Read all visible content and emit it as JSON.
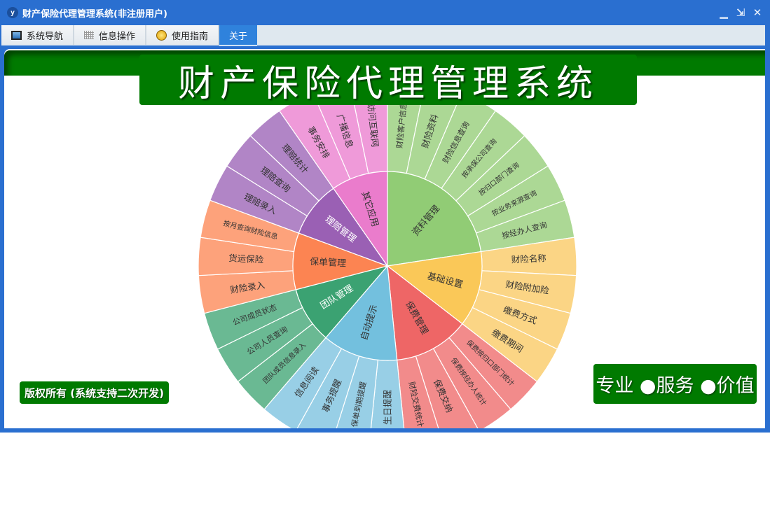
{
  "window": {
    "logo_text": "y",
    "title": "财产保险代理管理系统(非注册用户)",
    "controls": {
      "minimize": "▁",
      "restore": "⇲",
      "close": "✕"
    }
  },
  "tabs": [
    {
      "label": "系统导航",
      "icon": "monitor-icon"
    },
    {
      "label": "信息操作",
      "icon": "grid-icon"
    },
    {
      "label": "使用指南",
      "icon": "help-icon"
    },
    {
      "label": "关于",
      "active": true
    }
  ],
  "banner": {
    "title": "财产保险代理管理系统"
  },
  "footer": {
    "copyright": "版权所有 (系统支持二次开发)",
    "slogan": "专业 ●服务 ●价值"
  },
  "menu_wheel": {
    "type": "sunburst",
    "groups": [
      {
        "name": "资料管理",
        "color": "#91cc75",
        "leaf_color": "#acd895",
        "children": [
          "财险客户信息",
          "财险资料",
          "财险信息查询",
          "按承保公司查询",
          "按归口部门查询",
          "按业务来源查询",
          "按经办人查询"
        ]
      },
      {
        "name": "基础设置",
        "color": "#fac858",
        "leaf_color": "#fbd585",
        "children": [
          "财险名称",
          "财险附加险",
          "缴费方式",
          "缴费期间"
        ]
      },
      {
        "name": "保费管理",
        "color": "#ee6666",
        "leaf_color": "#f28b8b",
        "children": [
          "保费按归口部门统计",
          "保费按经办人统计",
          "保费交纳",
          "财险交费统计"
        ]
      },
      {
        "name": "自动提示",
        "color": "#73c0de",
        "leaf_color": "#98cfe6",
        "children": [
          "生日提醒",
          "保单到期提醒",
          "事务提醒",
          "信息阅读"
        ]
      },
      {
        "name": "团队管理",
        "color": "#3ba272",
        "leaf_color": "#6ab993",
        "light_label": true,
        "children": [
          "团队成员信息录入",
          "公司人员查询",
          "公司成员状态"
        ]
      },
      {
        "name": "保单管理",
        "color": "#fc8452",
        "leaf_color": "#fda27b",
        "children": [
          "财险录入",
          "货运保险",
          "按月查询财险信息"
        ]
      },
      {
        "name": "理赔管理",
        "color": "#9a60b4",
        "leaf_color": "#b185c6",
        "light_label": true,
        "children": [
          "理赔录入",
          "理赔查询",
          "理赔统计"
        ]
      },
      {
        "name": "其它应用",
        "color": "#ea7ccc",
        "leaf_color": "#ef9ad9",
        "children": [
          "事务安排",
          "广播信息",
          "访问互联网"
        ]
      }
    ]
  }
}
